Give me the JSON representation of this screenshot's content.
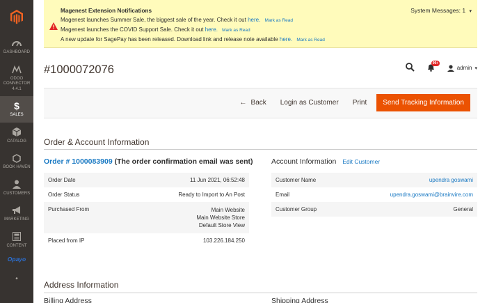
{
  "sidebar": {
    "items": [
      {
        "label": "DASHBOARD",
        "icon": "dashboard-icon"
      },
      {
        "label": "ODOO\nCONNECTOR\n4.4.1",
        "icon": "odoo-connector-icon"
      },
      {
        "label": "SALES",
        "icon": "dollar-icon",
        "active": true
      },
      {
        "label": "CATALOG",
        "icon": "cube-icon"
      },
      {
        "label": "BOOK HAVEN",
        "icon": "hexagon-icon"
      },
      {
        "label": "CUSTOMERS",
        "icon": "customers-icon"
      },
      {
        "label": "MARKETING",
        "icon": "megaphone-icon"
      },
      {
        "label": "CONTENT",
        "icon": "content-icon"
      }
    ],
    "opayo": "Opayo",
    "more": "•"
  },
  "notifications": {
    "title": "Magenest Extension Notifications",
    "mark_as_read": "Mark as Read",
    "here": "here.",
    "messages": [
      "Magenest launches Summer Sale, the biggest sale of the year. Check it out",
      "Magenest launches the COVID Support Sale. Check it out",
      "A new update for SagePay has been released. Download link and release note available"
    ],
    "system_messages": "System Messages: 1"
  },
  "header": {
    "order_number": "#1000072076",
    "notification_count": "99+",
    "user": "admin"
  },
  "actions": {
    "back": "Back",
    "login_as_customer": "Login as Customer",
    "print": "Print",
    "send_tracking": "Send Tracking Information"
  },
  "order_account": {
    "section_title": "Order & Account Information",
    "order_link": "Order # 1000083909",
    "order_note": "(The order confirmation email was sent)",
    "order_rows": [
      {
        "label": "Order Date",
        "value": "11 Jun 2021, 06:52:48"
      },
      {
        "label": "Order Status",
        "value": "Ready to Import to An Post"
      },
      {
        "label": "Purchased From",
        "value_lines": [
          "Main Website",
          "Main Website Store",
          "Default Store View"
        ]
      },
      {
        "label": "Placed from IP",
        "value": "103.226.184.250"
      }
    ],
    "account_title": "Account Information",
    "edit_customer": "Edit Customer",
    "account_rows": [
      {
        "label": "Customer Name",
        "value": "upendra goswami",
        "link": true
      },
      {
        "label": "Email",
        "value": "upendra.goswami@brainvire.com",
        "link": true
      },
      {
        "label": "Customer Group",
        "value": "General"
      }
    ]
  },
  "address": {
    "section_title": "Address Information",
    "billing": "Billing Address",
    "shipping": "Shipping Address"
  },
  "colors": {
    "accent": "#eb5202",
    "sidebar_bg": "#373330",
    "link": "#1979c3",
    "banner_bg": "#fffbbb"
  }
}
